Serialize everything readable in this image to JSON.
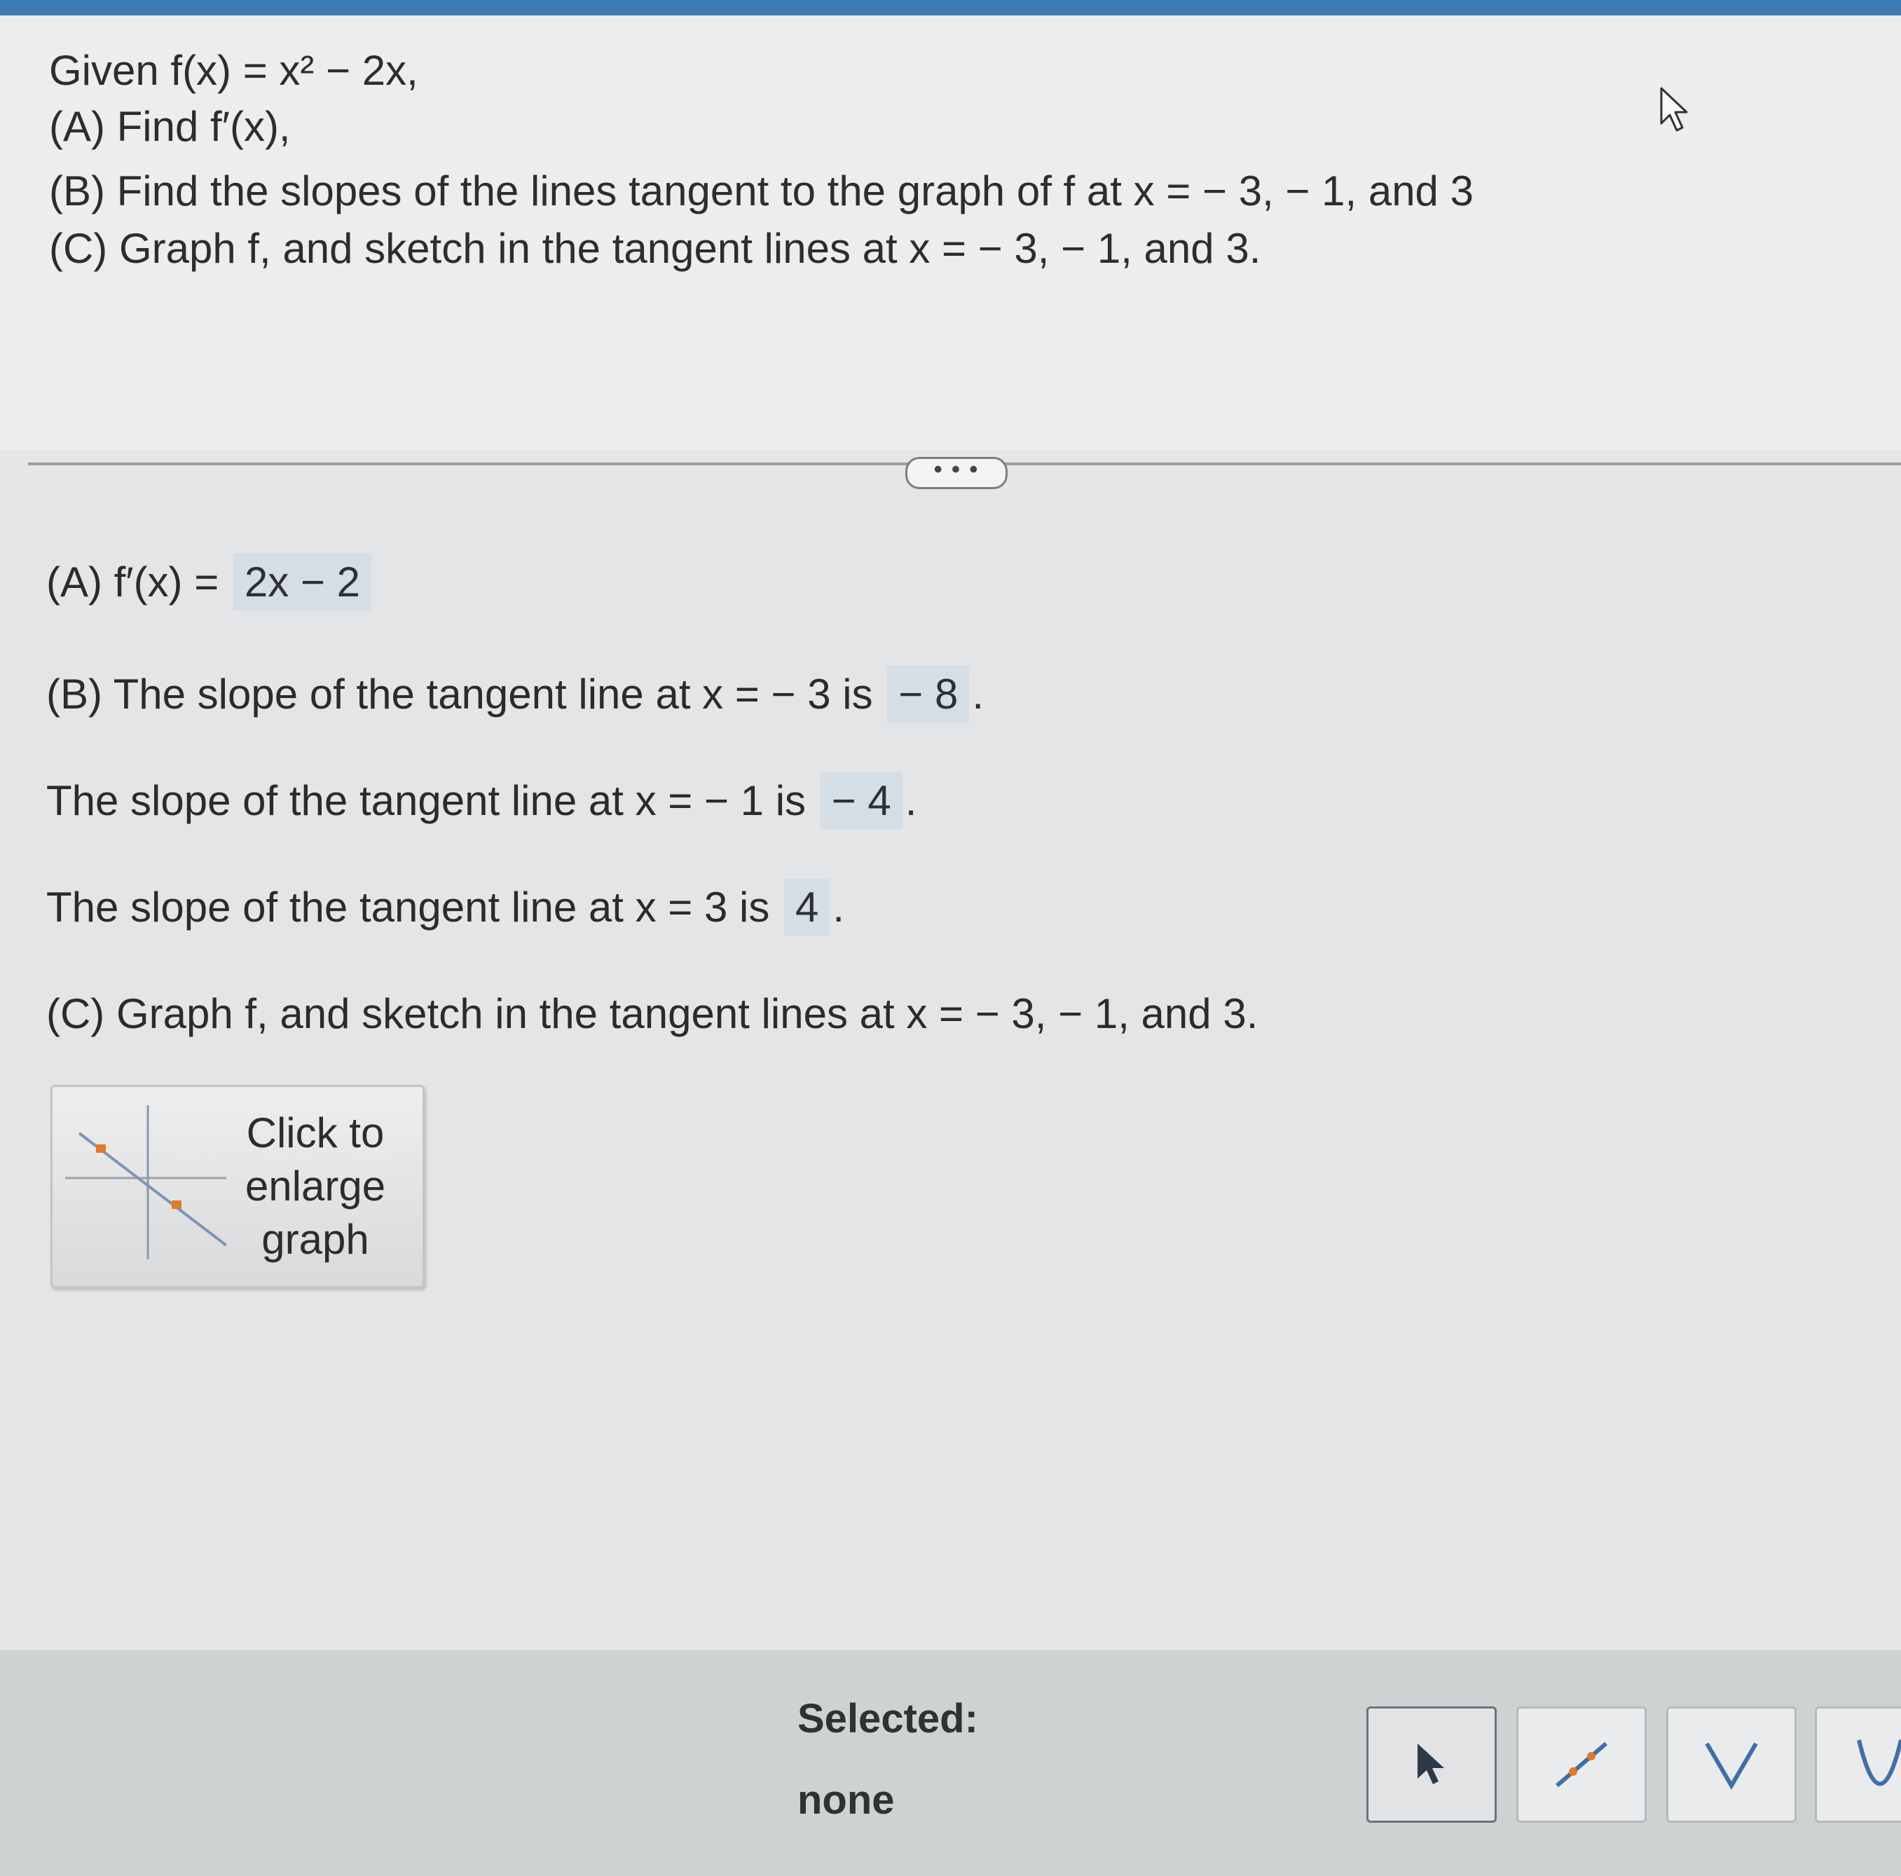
{
  "problem": {
    "given": "Given f(x) = x² − 2x,",
    "part_a": "(A)  Find f′(x),",
    "part_b": "(B)  Find the slopes of the lines tangent to the graph of f at x = − 3,  − 1, and 3",
    "part_c": "(C)  Graph f, and sketch in the tangent lines at x = − 3,  − 1, and 3."
  },
  "more_button": "• • •",
  "answers": {
    "a_prefix": "(A)  f′(x) =",
    "a_value": "2x − 2",
    "b1_prefix": "(B)  The slope of the tangent line at x = − 3 is",
    "b1_value": "− 8",
    "b2_prefix": "The slope of the tangent line at x = − 1 is",
    "b2_value": "− 4",
    "b3_prefix": "The slope of the tangent line at x = 3 is",
    "b3_value": "4",
    "end_period": ".",
    "c_text": "(C)  Graph f, and sketch in the tangent lines at x = − 3,  − 1, and 3."
  },
  "enlarge_button": {
    "line1": "Click to",
    "line2": "enlarge",
    "line3": "graph"
  },
  "toolbar": {
    "selected_label": "Selected:",
    "selected_value": "none",
    "tools": [
      "pointer-icon",
      "line-icon",
      "v-shape-icon",
      "parabola-icon"
    ]
  },
  "colors": {
    "answer_highlight": "#d5dde5",
    "top_strip": "#3d7bb5",
    "thumb_accent": "#e07a2a"
  }
}
